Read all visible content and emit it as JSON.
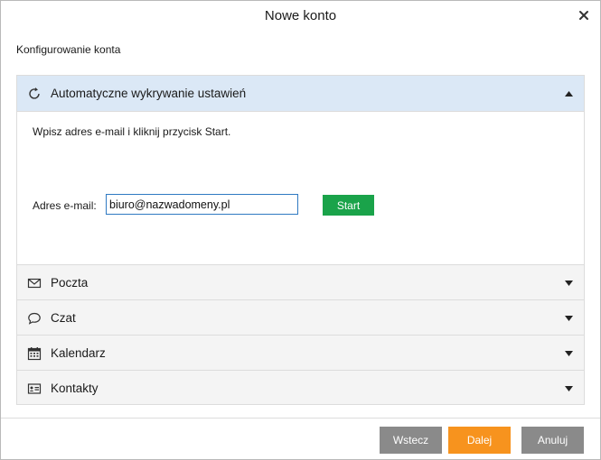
{
  "window": {
    "title": "Nowe konto"
  },
  "subtitle": "Konfigurowanie konta",
  "auto": {
    "label": "Automatyczne wykrywanie ustawień",
    "instruction": "Wpisz adres e-mail i kliknij przycisk Start.",
    "email_label": "Adres e-mail:",
    "email_value": "biuro@nazwadomeny.pl",
    "start_label": "Start"
  },
  "sections": [
    {
      "label": "Poczta",
      "icon": "envelope-icon"
    },
    {
      "label": "Czat",
      "icon": "chat-bubble-icon"
    },
    {
      "label": "Kalendarz",
      "icon": "calendar-icon"
    },
    {
      "label": "Kontakty",
      "icon": "contact-card-icon"
    }
  ],
  "footer": {
    "back_label": "Wstecz",
    "next_label": "Dalej",
    "cancel_label": "Anuluj"
  },
  "colors": {
    "active_header": "#dbe8f6",
    "start_button": "#1aa34a",
    "next_button": "#f7931e",
    "gray_button": "#8a8a8a",
    "input_border": "#2f79c2"
  }
}
